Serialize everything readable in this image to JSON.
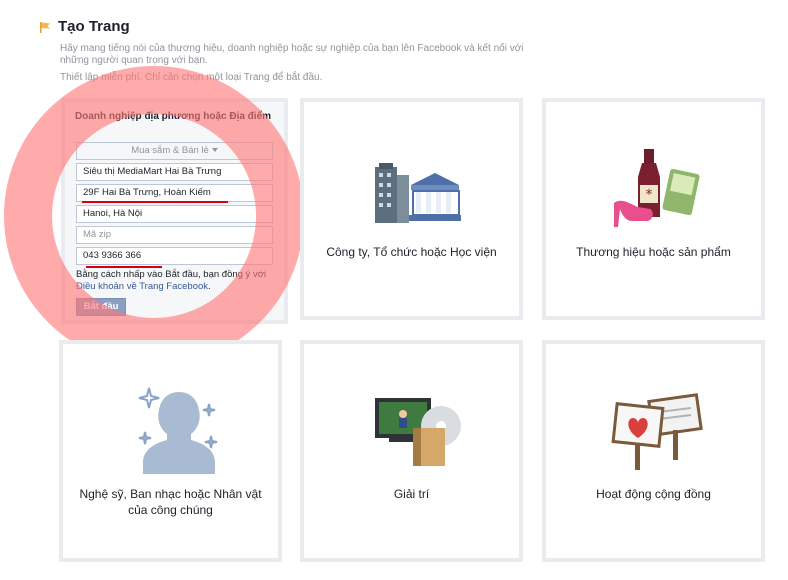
{
  "header": {
    "title": "Tạo Trang",
    "description_line1": "Hãy mang tiếng nói của thương hiệu, doanh nghiệp hoặc sự nghiệp của bạn lên Facebook và kết nối với những người quan trọng với bạn.",
    "description_line2": "Thiết lập miễn phí. Chỉ cần chọn một loại Trang để bắt đầu."
  },
  "form": {
    "heading": "Doanh nghiệp địa phương hoặc Địa điểm",
    "category": "Mua sắm & Bán lẻ",
    "business_name": "Siêu thị MediaMart Hai Bà Trưng",
    "address": "29F Hai Bà Trưng, Hoàn Kiếm",
    "city": "Hanoi, Hà Nội",
    "zip_placeholder": "Mã zip",
    "phone": "043 9366 366",
    "terms_prefix": "Bằng cách nhấp vào Bắt đầu, bạn đồng ý với ",
    "terms_link": "Điều khoản về Trang Facebook",
    "terms_suffix": ".",
    "start_button": "Bắt đầu"
  },
  "categories": [
    {
      "label": "Công ty, Tổ chức hoặc Học viện",
      "icon": "company-building-icon"
    },
    {
      "label": "Thương hiệu hoặc sản phẩm",
      "icon": "brand-product-icon"
    },
    {
      "label": "Nghệ sỹ, Ban nhạc hoặc Nhân vật của công chúng",
      "icon": "artist-silhouette-icon"
    },
    {
      "label": "Giải trí",
      "icon": "entertainment-icon"
    },
    {
      "label": "Hoạt động cộng đồng",
      "icon": "community-signs-icon"
    }
  ],
  "colors": {
    "overlay": "#ff7878",
    "link": "#365899",
    "underline": "#d8000c",
    "button": "#8b9dc3"
  }
}
